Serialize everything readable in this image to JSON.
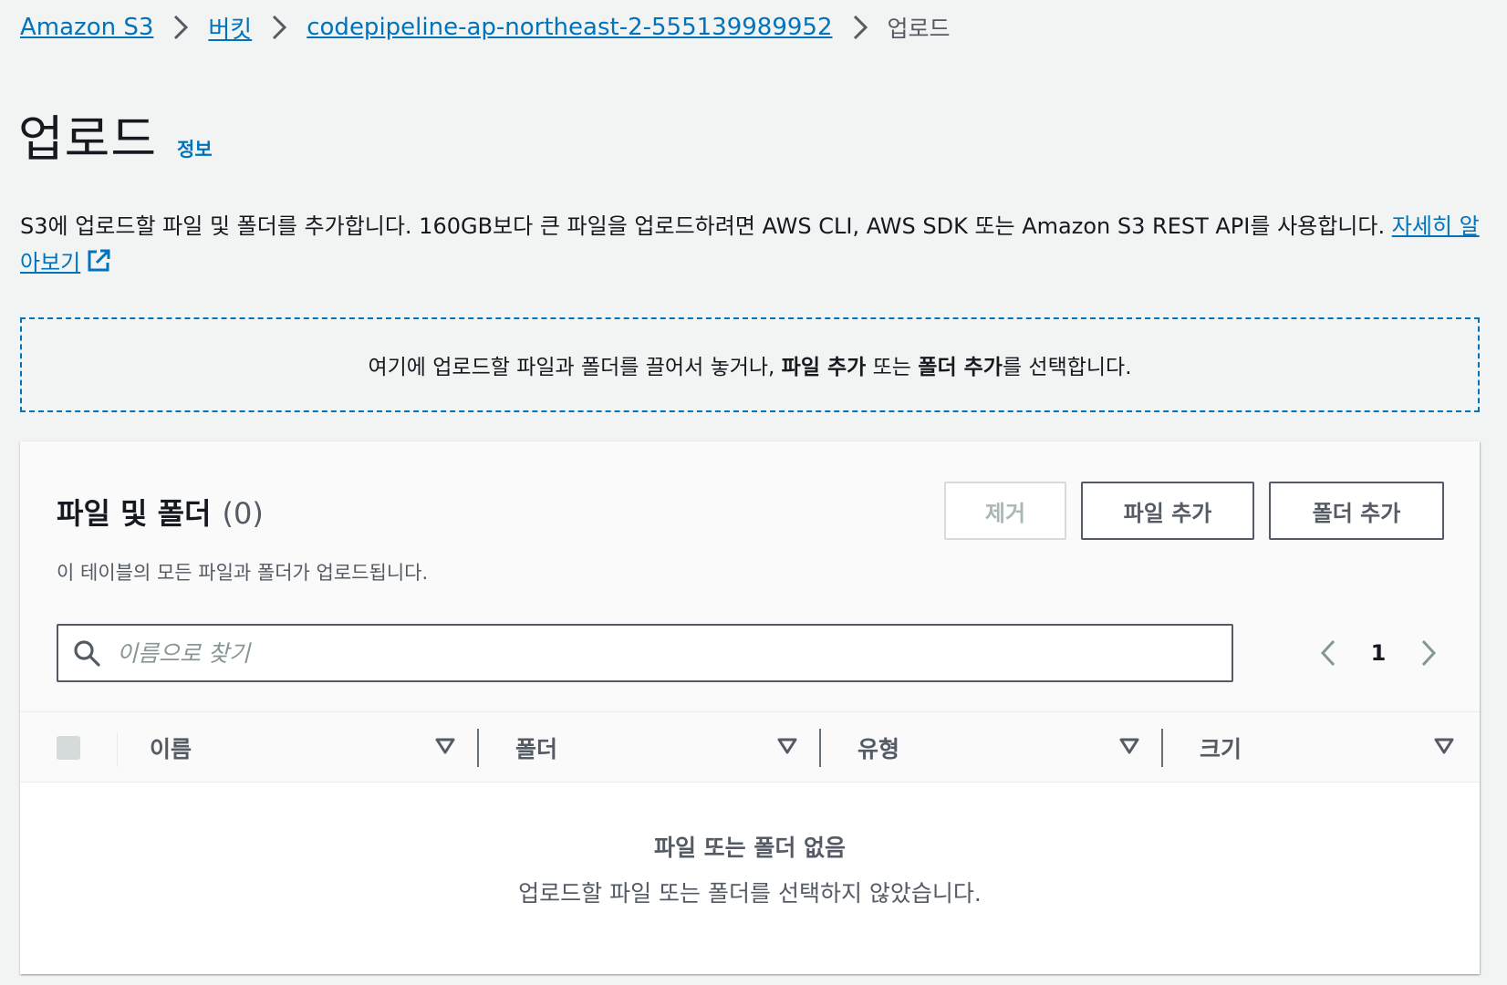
{
  "breadcrumb": {
    "items": [
      "Amazon S3",
      "버킷",
      "codepipeline-ap-northeast-2-555139989952"
    ],
    "current": "업로드"
  },
  "page": {
    "title": "업로드",
    "info_link": "정보"
  },
  "description": {
    "text": "S3에 업로드할 파일 및 폴더를 추가합니다. 160GB보다 큰 파일을 업로드하려면 AWS CLI, AWS SDK 또는 Amazon S3 REST API를 사용합니다.",
    "learn_more": "자세히 알아보기"
  },
  "dropzone": {
    "prefix": "여기에 업로드할 파일과 폴더를 끌어서 놓거나, ",
    "add_files": "파일 추가",
    "middle": " 또는 ",
    "add_folder": "폴더 추가",
    "suffix": "를 선택합니다."
  },
  "table": {
    "title": "파일 및 폴더",
    "count": "(0)",
    "subtitle": "이 테이블의 모든 파일과 폴더가 업로드됩니다.",
    "buttons": {
      "remove": "제거",
      "add_files": "파일 추가",
      "add_folder": "폴더 추가"
    },
    "search_placeholder": "이름으로 찾기",
    "page": "1",
    "columns": [
      "이름",
      "폴더",
      "유형",
      "크기"
    ],
    "empty_title": "파일 또는 폴더 없음",
    "empty_subtitle": "업로드할 파일 또는 폴더를 선택하지 않았습니다."
  },
  "colors": {
    "link": "#0073bb",
    "text": "#16191f",
    "muted": "#545b64",
    "background": "#f2f3f3"
  }
}
